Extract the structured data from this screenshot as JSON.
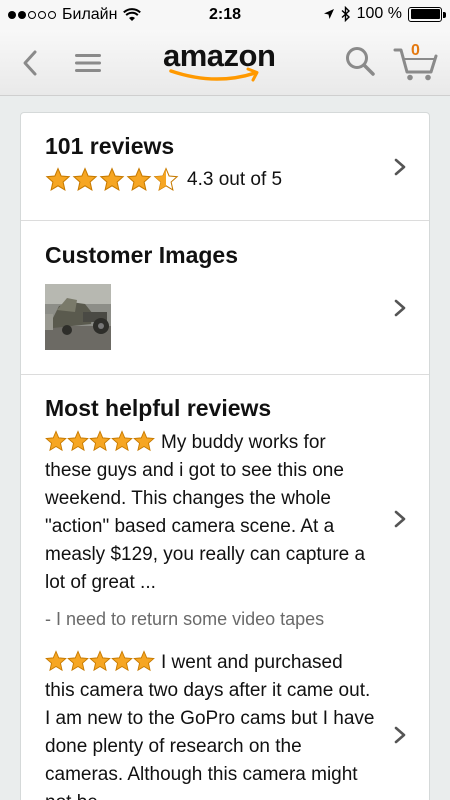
{
  "status": {
    "carrier": "Билайн",
    "time": "2:18",
    "battery": "100 %"
  },
  "nav": {
    "logo": "amazon",
    "cart_count": "0"
  },
  "reviews_summary": {
    "title": "101 reviews",
    "rating_text": "4.3 out of 5",
    "rating_value": 4.3
  },
  "customer_images": {
    "title": "Customer Images"
  },
  "helpful": {
    "title": "Most helpful reviews",
    "reviews": [
      {
        "stars": 5,
        "text": "My buddy works for these guys and i got to see this one weekend. This changes the whole \"action\" based camera scene. At a measly $129, you really can capture a lot of great ...",
        "author": "- I need to return some video tapes"
      },
      {
        "stars": 5,
        "text": "I went and purchased this camera two days after it came out. I am new to the GoPro cams but I have done plenty of research on the cameras. Although this camera might not be"
      }
    ]
  },
  "colors": {
    "star": "#f6a623",
    "cart_count": "#e47911",
    "smile": "#ff9900"
  }
}
